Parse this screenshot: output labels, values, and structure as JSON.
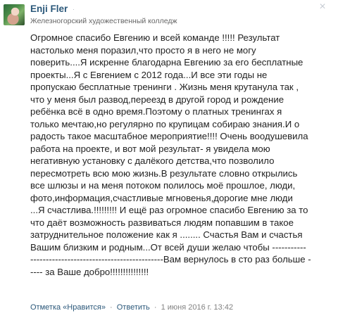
{
  "comment": {
    "author": "Enji Fler",
    "online_dot": "·",
    "school": "Железногорский художественный колледж",
    "text_lines": [
      "Огромное спасибо Евгению и всей команде !!!!! Результат",
      "настолько меня поразил,что просто я в него не могу",
      "поверить....Я искренне благодарна Евгению за его бесплатные",
      "проекты...Я с Евгением с 2012 года...И все эти годы не",
      "пропускаю бесплатные тренинги . Жизнь меня крутанула так ,",
      "что у меня был развод,переезд в другой город и рождение",
      "ребёнка всё в одно время.Поэтому о платных тренингах я",
      "только мечтаю,но регулярно по крупицам собираю знания.И о",
      "радость такое масштабное мероприятие!!!! Очень воодушевила",
      "работа на проекте, и вот мой результат- я увидела мою",
      "негативную установку с далёкого детства,что позволило",
      "пересмотреть всю мою жизнь.В результате словно открылись",
      "все шлюзы и на меня потоком полилось моё прошлое, люди,",
      "фото,информация,счастливые мгновенья,дорогие мне люди",
      "...Я счастлива.!!!!!!!!! И ещё раз огромное спасибо Евгению за то",
      "что даёт возможность развиваться людям попавшим в такое",
      "затруднительное положение как я ........ Счастья Вам и счастья",
      "Вашим близким и родным...От всей души желаю чтобы -----------",
      "-------------------------------------------Вам вернулось в сто раз больше -",
      "---- за Ваше добро!!!!!!!!!!!!!!!"
    ]
  },
  "footer": {
    "mark": "Отметка «Нравится»",
    "separator": "·",
    "reply": "Ответить",
    "date": "1 июня 2016 г. 13:42"
  },
  "icons": {
    "close": "close-icon"
  },
  "colors": {
    "link": "#2b587a",
    "meta": "#828282"
  }
}
